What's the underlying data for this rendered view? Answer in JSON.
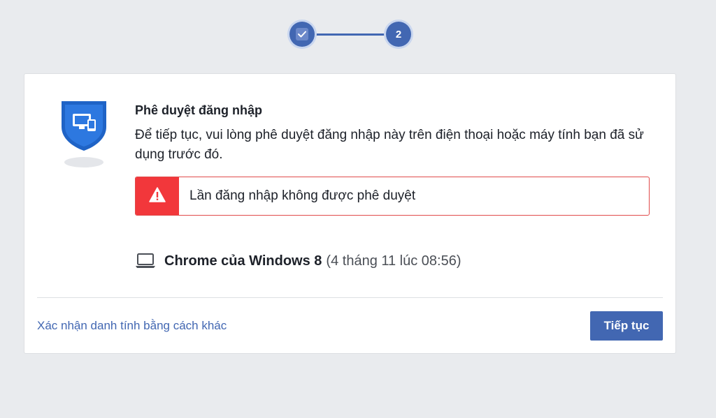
{
  "stepper": {
    "step1_icon": "check-icon",
    "step2_label": "2",
    "current_step": 2,
    "total_steps": 2
  },
  "card": {
    "shield_icon": "shield-devices-icon",
    "title": "Phê duyệt đăng nhập",
    "description": "Để tiếp tục, vui lòng phê duyệt đăng nhập này trên điện thoại hoặc máy tính bạn đã sử dụng trước đó.",
    "alert": {
      "icon": "warning-icon",
      "text": "Lần đăng nhập không được phê duyệt",
      "color": "#f2373b"
    },
    "device": {
      "icon": "laptop-icon",
      "name": "Chrome của Windows 8",
      "time": "(4 tháng 11 lúc 08:56)"
    }
  },
  "footer": {
    "alt_link": "Xác nhận danh tính bằng cách khác",
    "continue_label": "Tiếp tục"
  },
  "colors": {
    "brand": "#4267b2",
    "background": "#e9ebee",
    "alert": "#f2373b"
  }
}
